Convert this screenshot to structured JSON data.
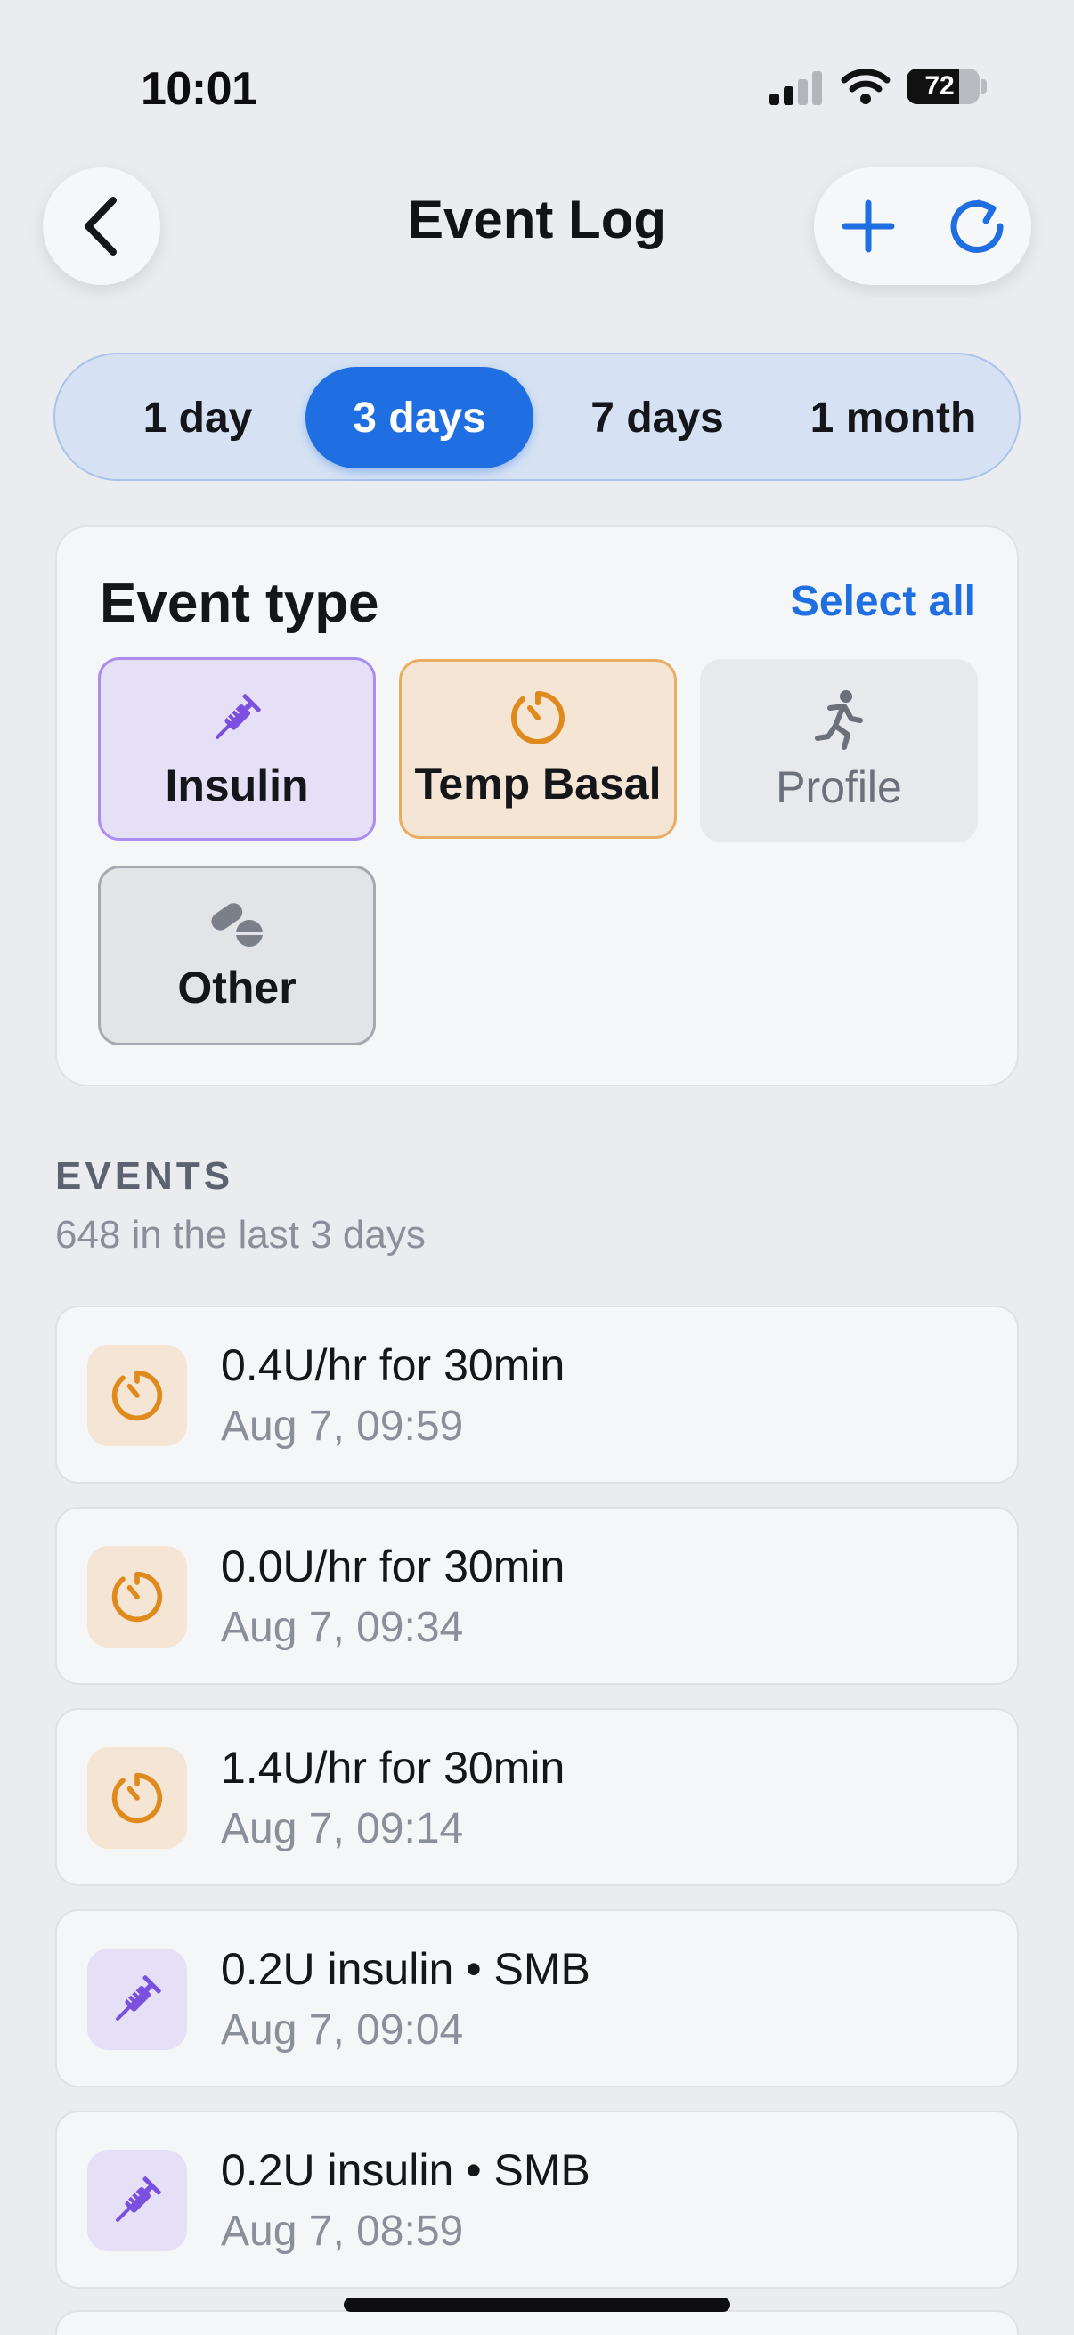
{
  "status_bar": {
    "time": "10:01",
    "battery": "72",
    "battery_level": 0.72
  },
  "nav": {
    "title": "Event Log"
  },
  "range": {
    "options": [
      "1 day",
      "3 days",
      "7 days",
      "1 month"
    ],
    "selected": "3 days"
  },
  "event_type": {
    "title": "Event type",
    "select_all": "Select all",
    "chips": [
      {
        "label": "Insulin",
        "icon": "syringe-icon",
        "selected": true,
        "color": "#7b4fe0"
      },
      {
        "label": "Temp Basal",
        "icon": "timer-icon",
        "selected": true,
        "color": "#e08a1e"
      },
      {
        "label": "Profile",
        "icon": "running-person-icon",
        "selected": false,
        "color": "#6c707a"
      },
      {
        "label": "Other",
        "icon": "pills-icon",
        "selected": true,
        "color": "#6c707a"
      }
    ]
  },
  "events": {
    "header": "EVENTS",
    "subtitle": "648 in the last 3 days",
    "items": [
      {
        "title": "0.4U/hr for 30min",
        "time": "Aug 7, 09:59",
        "kind": "timer-icon"
      },
      {
        "title": "0.0U/hr for 30min",
        "time": "Aug 7, 09:34",
        "kind": "timer-icon"
      },
      {
        "title": "1.4U/hr for 30min",
        "time": "Aug 7, 09:14",
        "kind": "timer-icon"
      },
      {
        "title": "0.2U insulin • SMB",
        "time": "Aug 7, 09:04",
        "kind": "syringe-icon"
      },
      {
        "title": "0.2U insulin • SMB",
        "time": "Aug 7, 08:59",
        "kind": "syringe-icon"
      }
    ]
  },
  "colors": {
    "accent": "#1f6fe3",
    "insulin": "#7b4fe0",
    "basal": "#e08a1e"
  }
}
